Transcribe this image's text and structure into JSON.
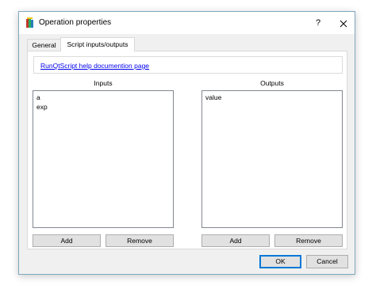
{
  "window": {
    "title": "Operation properties",
    "help_label": "?"
  },
  "tabs": [
    {
      "label": "General",
      "selected": false
    },
    {
      "label": "Script inputs/outputs",
      "selected": true
    }
  ],
  "help_link": "RunQtScript help documention page",
  "inputs": {
    "label": "Inputs",
    "items": [
      "a",
      "exp"
    ],
    "add_label": "Add",
    "remove_label": "Remove"
  },
  "outputs": {
    "label": "Outputs",
    "items": [
      "value"
    ],
    "add_label": "Add",
    "remove_label": "Remove"
  },
  "footer": {
    "ok_label": "OK",
    "cancel_label": "Cancel"
  },
  "colors": {
    "accent": "#0078d7",
    "link": "#0000ee"
  }
}
